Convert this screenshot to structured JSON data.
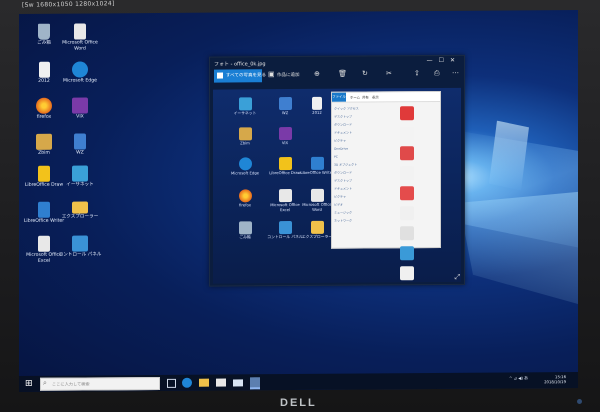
{
  "monitor": {
    "top_label": "[Sw 1680x1050 1280x1024]",
    "brand": "DELL"
  },
  "desktop_icons": [
    {
      "label": "ごみ箱",
      "icon": "recycle-bin-icon",
      "color": "#9fb4c8"
    },
    {
      "label": "Microsoft Office Word",
      "icon": "word-doc-icon",
      "color": "#e8e8e8"
    },
    {
      "label": "2012",
      "icon": "document-icon",
      "color": "#f0f0f0"
    },
    {
      "label": "Microsoft Edge",
      "icon": "edge-icon",
      "color": "#1f86d6"
    },
    {
      "label": "firefox",
      "icon": "firefox-icon",
      "color": "#e66a1e"
    },
    {
      "label": "VIX",
      "icon": "vix-icon",
      "color": "#7a3aa8"
    },
    {
      "label": "Zbim",
      "icon": "zbim-icon",
      "color": "#d6a84a"
    },
    {
      "label": "WZ",
      "icon": "wz-icon",
      "color": "#3f7fd0"
    },
    {
      "label": "LibreOffice Draw",
      "icon": "libreoffice-draw-icon",
      "color": "#f2c21b"
    },
    {
      "label": "イーサネット",
      "icon": "ethernet-icon",
      "color": "#3aa0d8"
    },
    {
      "label": "LibreOffice Writer",
      "icon": "libreoffice-writer-icon",
      "color": "#2f7fd0"
    },
    {
      "label": "エクスプローラー",
      "icon": "explorer-icon",
      "color": "#f0c14a"
    },
    {
      "label": "Microsoft Office Excel",
      "icon": "excel-icon",
      "color": "#e8e8e8"
    },
    {
      "label": "コントロール パネル",
      "icon": "control-panel-icon",
      "color": "#3a92d6"
    }
  ],
  "photos_window": {
    "title": "フォト - office_0k.jpg",
    "view_all_label": "すべての写真を見る",
    "add_to_album_label": "作品に追加",
    "toolbar_icons": [
      "zoom-icon",
      "delete-icon",
      "rotate-icon",
      "crop-icon",
      "share-icon",
      "print-icon",
      "more-icon"
    ],
    "controls": [
      "—",
      "☐",
      "✕"
    ]
  },
  "photo_content": {
    "icons": [
      {
        "label": "イーサネット",
        "color": "#3aa0d8"
      },
      {
        "label": "WZ",
        "color": "#3f7fd0"
      },
      {
        "label": "2012",
        "color": "#f0f0f0"
      },
      {
        "label": "Zbim",
        "color": "#d6a84a"
      },
      {
        "label": "VIX",
        "color": "#7a3aa8"
      },
      {
        "label": "Microsoft Edge",
        "color": "#1f86d6"
      },
      {
        "label": "LibreOffice Draw",
        "color": "#f2c21b"
      },
      {
        "label": "LibreOffice Writer",
        "color": "#2f7fd0"
      },
      {
        "label": "firefox",
        "color": "#e66a1e"
      },
      {
        "label": "Microsoft Office Excel",
        "color": "#e8e8e8"
      },
      {
        "label": "Microsoft Office Word",
        "color": "#e8e8e8"
      },
      {
        "label": "ごみ箱",
        "color": "#9fb4c8"
      },
      {
        "label": "コントロール パネル",
        "color": "#3a92d6"
      },
      {
        "label": "エクスプローラー",
        "color": "#f0c14a"
      }
    ],
    "explorer": {
      "tabs": [
        "ファイル",
        "ホーム",
        "共有",
        "表示"
      ],
      "nav_rows": [
        "クイック アクセス",
        "デスクトップ",
        "ダウンロード",
        "ドキュメント",
        "ピクチャ",
        "OneDrive",
        "PC",
        "3D オブジェクト",
        "ダウンロード",
        "デスクトップ",
        "ドキュメント",
        "ピクチャ",
        "ビデオ",
        "ミュージック",
        "ネットワーク"
      ],
      "thumb_colors": [
        "#e03a3a",
        "#f3f3f3",
        "#e04a4a",
        "#f2f2f2",
        "#e44c4c",
        "#f0f0f0",
        "#e0e0e0",
        "#3a9ad8",
        "#f0f0f0"
      ]
    }
  },
  "taskbar": {
    "search_placeholder": "ここに入力して検索",
    "pinned_icons": [
      "task-view-icon",
      "edge-icon",
      "explorer-icon",
      "store-icon",
      "mail-icon",
      "photos-icon"
    ],
    "tray_text": "^ ⊿ ◀) あ",
    "time": "15:16",
    "date": "2018/10/19"
  }
}
